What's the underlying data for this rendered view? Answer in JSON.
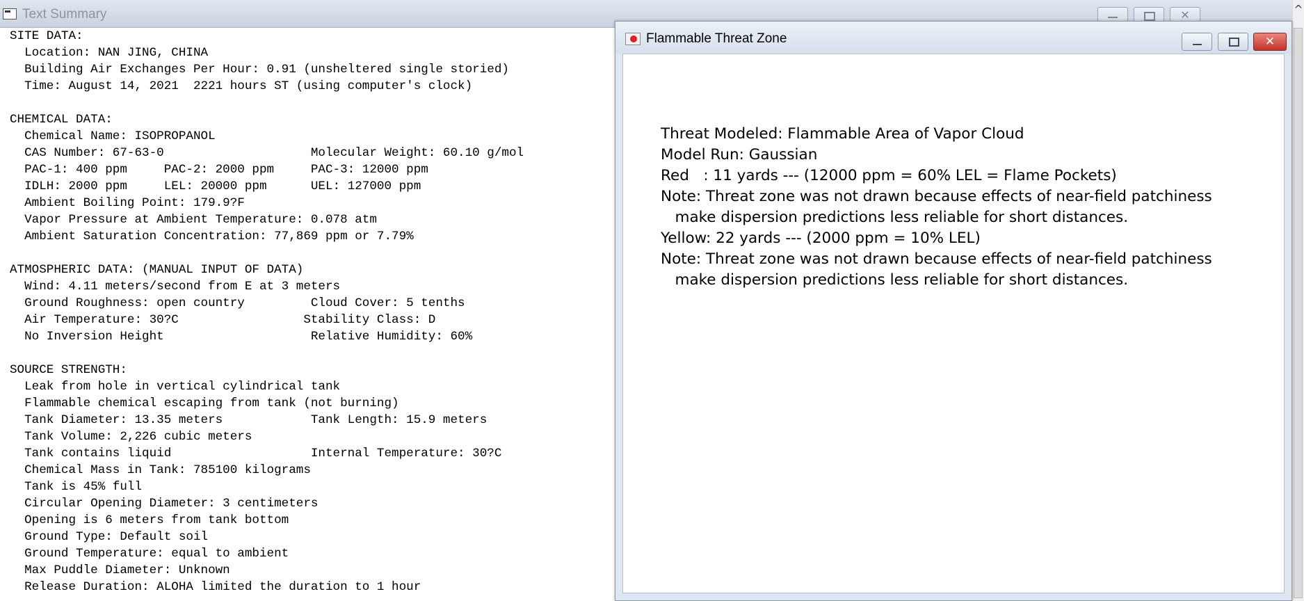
{
  "text_summary": {
    "title": "Text Summary",
    "close_glyph": "✕",
    "scroll_up_glyph": "^",
    "lines": [
      "SITE DATA:",
      "  Location: NAN JING, CHINA",
      "  Building Air Exchanges Per Hour: 0.91 (unsheltered single storied)",
      "  Time: August 14, 2021  2221 hours ST (using computer's clock)",
      "",
      "CHEMICAL DATA:",
      "  Chemical Name: ISOPROPANOL",
      "  CAS Number: 67-63-0                    Molecular Weight: 60.10 g/mol",
      "  PAC-1: 400 ppm     PAC-2: 2000 ppm     PAC-3: 12000 ppm",
      "  IDLH: 2000 ppm     LEL: 20000 ppm      UEL: 127000 ppm",
      "  Ambient Boiling Point: 179.9?F",
      "  Vapor Pressure at Ambient Temperature: 0.078 atm",
      "  Ambient Saturation Concentration: 77,869 ppm or 7.79%",
      "",
      "ATMOSPHERIC DATA: (MANUAL INPUT OF DATA)",
      "  Wind: 4.11 meters/second from E at 3 meters",
      "  Ground Roughness: open country         Cloud Cover: 5 tenths",
      "  Air Temperature: 30?C                 Stability Class: D",
      "  No Inversion Height                    Relative Humidity: 60%",
      "",
      "SOURCE STRENGTH:",
      "  Leak from hole in vertical cylindrical tank",
      "  Flammable chemical escaping from tank (not burning)",
      "  Tank Diameter: 13.35 meters            Tank Length: 15.9 meters",
      "  Tank Volume: 2,226 cubic meters",
      "  Tank contains liquid                   Internal Temperature: 30?C",
      "  Chemical Mass in Tank: 785100 kilograms",
      "  Tank is 45% full",
      "  Circular Opening Diameter: 3 centimeters",
      "  Opening is 6 meters from tank bottom",
      "  Ground Type: Default soil",
      "  Ground Temperature: equal to ambient",
      "  Max Puddle Diameter: Unknown",
      "  Release Duration: ALOHA limited the duration to 1 hour"
    ]
  },
  "threat_zone": {
    "title": "Flammable Threat Zone",
    "close_glyph": "✕",
    "lines": [
      "Threat Modeled: Flammable Area of Vapor Cloud",
      "Model Run: Gaussian",
      "Red   : 11 yards --- (12000 ppm = 60% LEL = Flame Pockets)",
      "Note: Threat zone was not drawn because effects of near-field patchiness",
      "   make dispersion predictions less reliable for short distances.",
      "Yellow: 22 yards --- (2000 ppm = 10% LEL)",
      "Note: Threat zone was not drawn because effects of near-field patchiness",
      "   make dispersion predictions less reliable for short distances."
    ]
  },
  "icons": {
    "text_summary_icon": "window-app-icon",
    "threat_zone_icon": "flame-red-dot-icon"
  },
  "colors": {
    "close_button_red": "#c4332a",
    "titlebar": "#d6e0ec"
  }
}
